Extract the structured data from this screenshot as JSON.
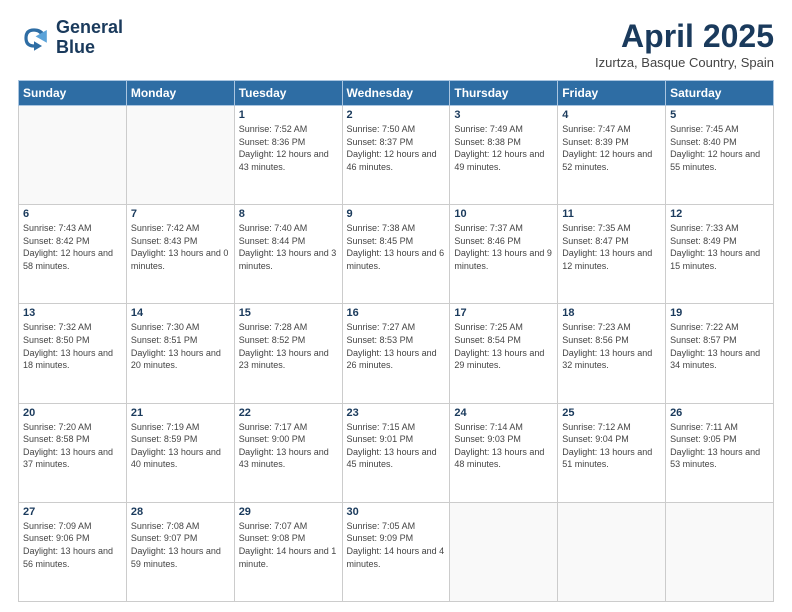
{
  "header": {
    "logo_line1": "General",
    "logo_line2": "Blue",
    "month": "April 2025",
    "location": "Izurtza, Basque Country, Spain"
  },
  "weekdays": [
    "Sunday",
    "Monday",
    "Tuesday",
    "Wednesday",
    "Thursday",
    "Friday",
    "Saturday"
  ],
  "weeks": [
    [
      {
        "day": "",
        "sunrise": "",
        "sunset": "",
        "daylight": ""
      },
      {
        "day": "",
        "sunrise": "",
        "sunset": "",
        "daylight": ""
      },
      {
        "day": "1",
        "sunrise": "Sunrise: 7:52 AM",
        "sunset": "Sunset: 8:36 PM",
        "daylight": "Daylight: 12 hours and 43 minutes."
      },
      {
        "day": "2",
        "sunrise": "Sunrise: 7:50 AM",
        "sunset": "Sunset: 8:37 PM",
        "daylight": "Daylight: 12 hours and 46 minutes."
      },
      {
        "day": "3",
        "sunrise": "Sunrise: 7:49 AM",
        "sunset": "Sunset: 8:38 PM",
        "daylight": "Daylight: 12 hours and 49 minutes."
      },
      {
        "day": "4",
        "sunrise": "Sunrise: 7:47 AM",
        "sunset": "Sunset: 8:39 PM",
        "daylight": "Daylight: 12 hours and 52 minutes."
      },
      {
        "day": "5",
        "sunrise": "Sunrise: 7:45 AM",
        "sunset": "Sunset: 8:40 PM",
        "daylight": "Daylight: 12 hours and 55 minutes."
      }
    ],
    [
      {
        "day": "6",
        "sunrise": "Sunrise: 7:43 AM",
        "sunset": "Sunset: 8:42 PM",
        "daylight": "Daylight: 12 hours and 58 minutes."
      },
      {
        "day": "7",
        "sunrise": "Sunrise: 7:42 AM",
        "sunset": "Sunset: 8:43 PM",
        "daylight": "Daylight: 13 hours and 0 minutes."
      },
      {
        "day": "8",
        "sunrise": "Sunrise: 7:40 AM",
        "sunset": "Sunset: 8:44 PM",
        "daylight": "Daylight: 13 hours and 3 minutes."
      },
      {
        "day": "9",
        "sunrise": "Sunrise: 7:38 AM",
        "sunset": "Sunset: 8:45 PM",
        "daylight": "Daylight: 13 hours and 6 minutes."
      },
      {
        "day": "10",
        "sunrise": "Sunrise: 7:37 AM",
        "sunset": "Sunset: 8:46 PM",
        "daylight": "Daylight: 13 hours and 9 minutes."
      },
      {
        "day": "11",
        "sunrise": "Sunrise: 7:35 AM",
        "sunset": "Sunset: 8:47 PM",
        "daylight": "Daylight: 13 hours and 12 minutes."
      },
      {
        "day": "12",
        "sunrise": "Sunrise: 7:33 AM",
        "sunset": "Sunset: 8:49 PM",
        "daylight": "Daylight: 13 hours and 15 minutes."
      }
    ],
    [
      {
        "day": "13",
        "sunrise": "Sunrise: 7:32 AM",
        "sunset": "Sunset: 8:50 PM",
        "daylight": "Daylight: 13 hours and 18 minutes."
      },
      {
        "day": "14",
        "sunrise": "Sunrise: 7:30 AM",
        "sunset": "Sunset: 8:51 PM",
        "daylight": "Daylight: 13 hours and 20 minutes."
      },
      {
        "day": "15",
        "sunrise": "Sunrise: 7:28 AM",
        "sunset": "Sunset: 8:52 PM",
        "daylight": "Daylight: 13 hours and 23 minutes."
      },
      {
        "day": "16",
        "sunrise": "Sunrise: 7:27 AM",
        "sunset": "Sunset: 8:53 PM",
        "daylight": "Daylight: 13 hours and 26 minutes."
      },
      {
        "day": "17",
        "sunrise": "Sunrise: 7:25 AM",
        "sunset": "Sunset: 8:54 PM",
        "daylight": "Daylight: 13 hours and 29 minutes."
      },
      {
        "day": "18",
        "sunrise": "Sunrise: 7:23 AM",
        "sunset": "Sunset: 8:56 PM",
        "daylight": "Daylight: 13 hours and 32 minutes."
      },
      {
        "day": "19",
        "sunrise": "Sunrise: 7:22 AM",
        "sunset": "Sunset: 8:57 PM",
        "daylight": "Daylight: 13 hours and 34 minutes."
      }
    ],
    [
      {
        "day": "20",
        "sunrise": "Sunrise: 7:20 AM",
        "sunset": "Sunset: 8:58 PM",
        "daylight": "Daylight: 13 hours and 37 minutes."
      },
      {
        "day": "21",
        "sunrise": "Sunrise: 7:19 AM",
        "sunset": "Sunset: 8:59 PM",
        "daylight": "Daylight: 13 hours and 40 minutes."
      },
      {
        "day": "22",
        "sunrise": "Sunrise: 7:17 AM",
        "sunset": "Sunset: 9:00 PM",
        "daylight": "Daylight: 13 hours and 43 minutes."
      },
      {
        "day": "23",
        "sunrise": "Sunrise: 7:15 AM",
        "sunset": "Sunset: 9:01 PM",
        "daylight": "Daylight: 13 hours and 45 minutes."
      },
      {
        "day": "24",
        "sunrise": "Sunrise: 7:14 AM",
        "sunset": "Sunset: 9:03 PM",
        "daylight": "Daylight: 13 hours and 48 minutes."
      },
      {
        "day": "25",
        "sunrise": "Sunrise: 7:12 AM",
        "sunset": "Sunset: 9:04 PM",
        "daylight": "Daylight: 13 hours and 51 minutes."
      },
      {
        "day": "26",
        "sunrise": "Sunrise: 7:11 AM",
        "sunset": "Sunset: 9:05 PM",
        "daylight": "Daylight: 13 hours and 53 minutes."
      }
    ],
    [
      {
        "day": "27",
        "sunrise": "Sunrise: 7:09 AM",
        "sunset": "Sunset: 9:06 PM",
        "daylight": "Daylight: 13 hours and 56 minutes."
      },
      {
        "day": "28",
        "sunrise": "Sunrise: 7:08 AM",
        "sunset": "Sunset: 9:07 PM",
        "daylight": "Daylight: 13 hours and 59 minutes."
      },
      {
        "day": "29",
        "sunrise": "Sunrise: 7:07 AM",
        "sunset": "Sunset: 9:08 PM",
        "daylight": "Daylight: 14 hours and 1 minute."
      },
      {
        "day": "30",
        "sunrise": "Sunrise: 7:05 AM",
        "sunset": "Sunset: 9:09 PM",
        "daylight": "Daylight: 14 hours and 4 minutes."
      },
      {
        "day": "",
        "sunrise": "",
        "sunset": "",
        "daylight": ""
      },
      {
        "day": "",
        "sunrise": "",
        "sunset": "",
        "daylight": ""
      },
      {
        "day": "",
        "sunrise": "",
        "sunset": "",
        "daylight": ""
      }
    ]
  ]
}
